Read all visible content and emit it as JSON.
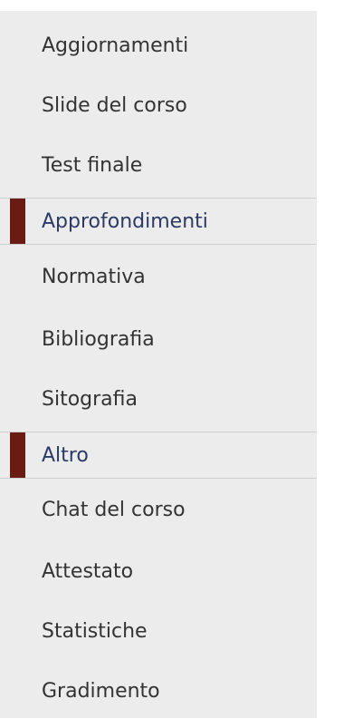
{
  "menu": {
    "items": [
      {
        "label": "Aggiornamenti"
      },
      {
        "label": "Slide del corso"
      },
      {
        "label": "Test finale"
      },
      {
        "label": "Approfondimenti"
      },
      {
        "label": "Normativa"
      },
      {
        "label": "Bibliografia"
      },
      {
        "label": "Sitografia"
      },
      {
        "label": "Altro"
      },
      {
        "label": "Chat del corso"
      },
      {
        "label": "Attestato"
      },
      {
        "label": "Statistiche"
      },
      {
        "label": "Gradimento"
      }
    ]
  }
}
